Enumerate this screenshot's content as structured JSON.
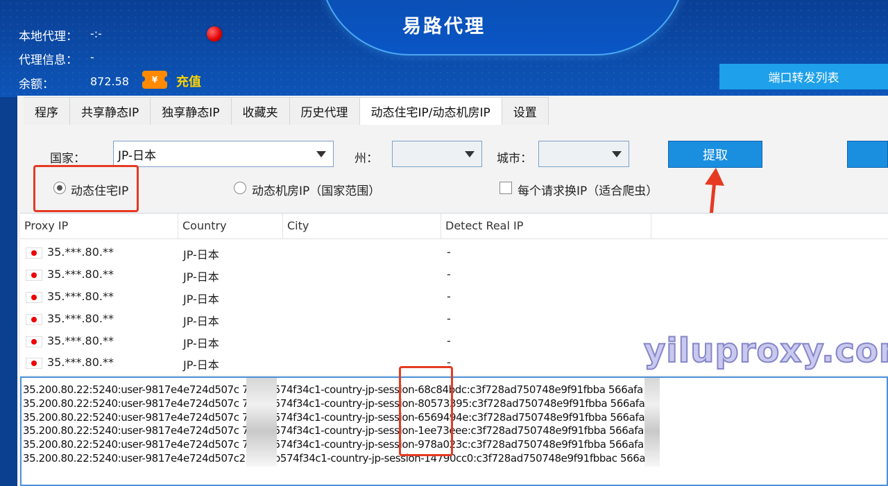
{
  "app": {
    "title": "易路代理"
  },
  "info": {
    "local_proxy_label": "本地代理：",
    "local_proxy_value": "-:-",
    "proxy_info_label": "代理信息：",
    "proxy_info_value": "-",
    "balance_label": "余额：",
    "balance_value": "872.58",
    "recharge_icon": "¥",
    "recharge_label": "充值"
  },
  "port_forward_button": "端口转发列表",
  "tabs": [
    {
      "label": "程序"
    },
    {
      "label": "共享静态IP"
    },
    {
      "label": "独享静态IP"
    },
    {
      "label": "收藏夹"
    },
    {
      "label": "历史代理"
    },
    {
      "label": "动态住宅IP/动态机房IP"
    },
    {
      "label": "设置"
    }
  ],
  "filters": {
    "country_label": "国家：",
    "country_value": "JP-日本",
    "state_label": "州：",
    "state_value": "",
    "city_label": "城市：",
    "city_value": "",
    "fetch_button": "提取"
  },
  "options": {
    "residential_label": "动态住宅IP",
    "datacenter_label": "动态机房IP（国家范围）",
    "rotate_label": "每个请求换IP（适合爬虫）",
    "residential_checked": true,
    "datacenter_checked": false,
    "rotate_checked": false
  },
  "table": {
    "headers": [
      "Proxy IP",
      "Country",
      "City",
      "Detect Real IP"
    ],
    "rows": [
      {
        "ip": "35.***.80.**",
        "country": "JP-日本",
        "city": "",
        "detect": "-"
      },
      {
        "ip": "35.***.80.**",
        "country": "JP-日本",
        "city": "",
        "detect": "-"
      },
      {
        "ip": "35.***.80.**",
        "country": "JP-日本",
        "city": "",
        "detect": "-"
      },
      {
        "ip": "35.***.80.**",
        "country": "JP-日本",
        "city": "",
        "detect": "-"
      },
      {
        "ip": "35.***.80.**",
        "country": "JP-日本",
        "city": "",
        "detect": "-"
      },
      {
        "ip": "35.***.80.**",
        "country": "JP-日本",
        "city": "",
        "detect": "-"
      }
    ]
  },
  "log_lines": [
    "35.200.80.22:5240:user-9817e4e724d507c     709bb574f34c1-country-jp-session-68c84bdc:c3f728ad750748e9f91fbba     566afa",
    "35.200.80.22:5240:user-9817e4e724d507c     709bb574f34c1-country-jp-session-80573395:c3f728ad750748e9f91fbba     566afa",
    "35.200.80.22:5240:user-9817e4e724d507c     709bb574f34c1-country-jp-session-6569494e:c3f728ad750748e9f91fbba     566afa",
    "35.200.80.22:5240:user-9817e4e724d507c     709bb574f34c1-country-jp-session-1ee73eee:c3f728ad750748e9f91fbba     566afa",
    "35.200.80.22:5240:user-9817e4e724d507c     709bb574f34c1-country-jp-session-978a023c:c3f728ad750748e9f91fbba     566afa",
    "35.200.80.22:5240:user-9817e4e724d507c2    709bb574f34c1-country-jp-session-14790cc0:c3f728ad750748e9f91fbbac    566afa"
  ],
  "watermark": "yiluproxy.com",
  "colors": {
    "header_bg": "#0d55b8",
    "accent_button": "#1a8fe0",
    "highlight_box": "#e63a23",
    "recharge_text": "#ffd400"
  }
}
